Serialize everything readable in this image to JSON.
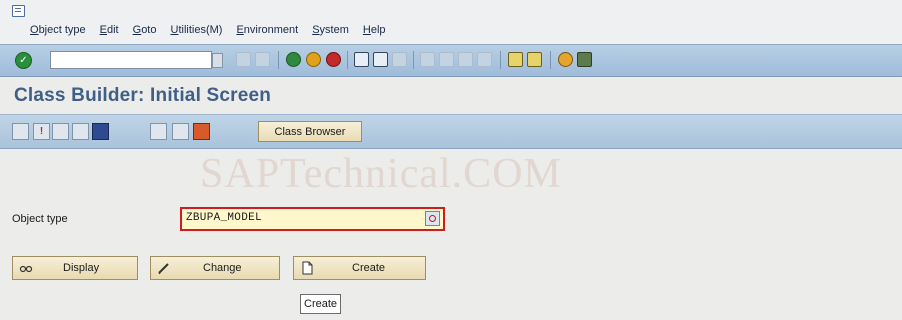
{
  "menu": {
    "items": [
      {
        "u": "O",
        "rest": "bject type"
      },
      {
        "u": "E",
        "rest": "dit"
      },
      {
        "u": "G",
        "rest": "oto"
      },
      {
        "u": "U",
        "rest": "tilities(M)"
      },
      {
        "u": "E",
        "rest": "nvironment"
      },
      {
        "u": "S",
        "rest": "ystem"
      },
      {
        "u": "H",
        "rest": "elp"
      }
    ]
  },
  "screen": {
    "title": "Class Builder: Initial Screen"
  },
  "app_toolbar": {
    "class_browser_label": "Class Browser"
  },
  "watermark": "SAPTechnical.COM",
  "form": {
    "object_type_label": "Object type",
    "object_type_value": "ZBUPA_MODEL"
  },
  "buttons": {
    "display": "Display",
    "change": "Change",
    "create": "Create"
  },
  "tooltip": "Create",
  "colors": {
    "title": "#3f5f86",
    "highlight_border": "#d01c1c",
    "input_background": "#fff7cc",
    "toolbar_blue": "#a9c3dc"
  }
}
